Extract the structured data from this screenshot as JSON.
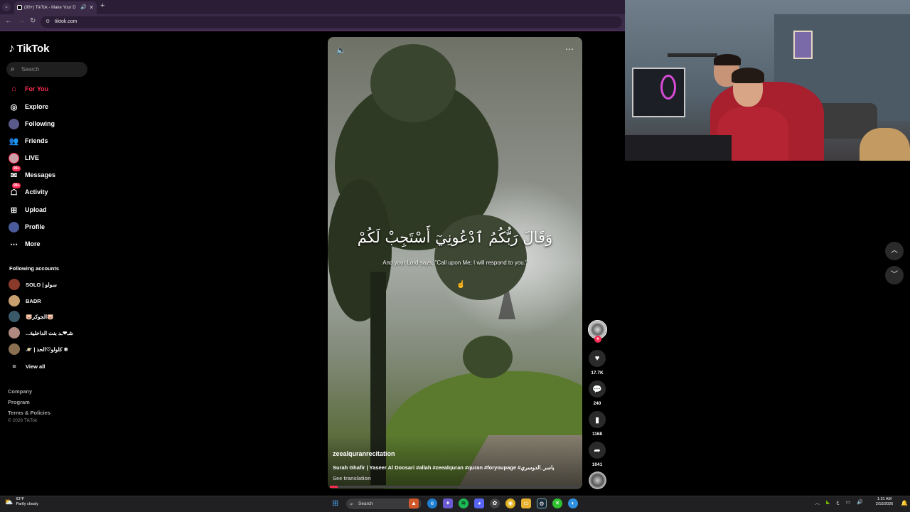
{
  "browser": {
    "tab_title": "(99+) TikTok - Make Your D",
    "url": "tiktok.com",
    "new_tab_symbol": "+",
    "close_symbol": "✕"
  },
  "sidebar": {
    "logo": "TikTok",
    "search_placeholder": "Search",
    "nav": [
      {
        "label": "For You",
        "icon": "home-icon",
        "active": true
      },
      {
        "label": "Explore",
        "icon": "compass-icon"
      },
      {
        "label": "Following",
        "icon": "following-avatar"
      },
      {
        "label": "Friends",
        "icon": "friends-icon"
      },
      {
        "label": "LIVE",
        "icon": "live-avatar"
      },
      {
        "label": "Messages",
        "icon": "messages-icon",
        "badge": "99+"
      },
      {
        "label": "Activity",
        "icon": "activity-icon",
        "badge": "99+"
      },
      {
        "label": "Upload",
        "icon": "upload-icon"
      },
      {
        "label": "Profile",
        "icon": "profile-avatar"
      },
      {
        "label": "More",
        "icon": "more-icon"
      }
    ],
    "following_title": "Following accounts",
    "accounts": [
      {
        "name": "SOLO | سولو"
      },
      {
        "name": "BADR"
      },
      {
        "name": "🐷الجوكر🐷"
      },
      {
        "name": "...شـ❤ـد بنت الداخلية"
      },
      {
        "name": "🪐 | كلولو♡الحذ ❄"
      }
    ],
    "view_all": "View all",
    "footer": [
      "Company",
      "Program",
      "Terms & Policies"
    ],
    "copyright": "© 2026 TikTok"
  },
  "video": {
    "arabic_text": "وَقَالَ رَبُّكُمُ ٱدْعُونِيٓ أَسْتَجِبْ لَكُمْ",
    "translation": "And your Lord says, \"Call upon Me; I will respond to you.\"",
    "author": "zeealquranrecitation",
    "description": "Surah Ghafir | Yaseer Al Doosari #allah #zeealquran  #quran #foryoupage #ياسر_الدوسري",
    "see_translation": "See translation",
    "progress": 0.03
  },
  "actions": {
    "likes": "17.7K",
    "comments": "240",
    "saves": "1168",
    "shares": "1041"
  },
  "taskbar": {
    "weather_temp": "63°F",
    "weather_desc": "Partly cloudy",
    "search": "Search",
    "time": "1:31 AM",
    "date": "2/10/2026",
    "lang": "ع"
  },
  "colors": {
    "accent": "#fe2c55",
    "background": "#000000"
  }
}
